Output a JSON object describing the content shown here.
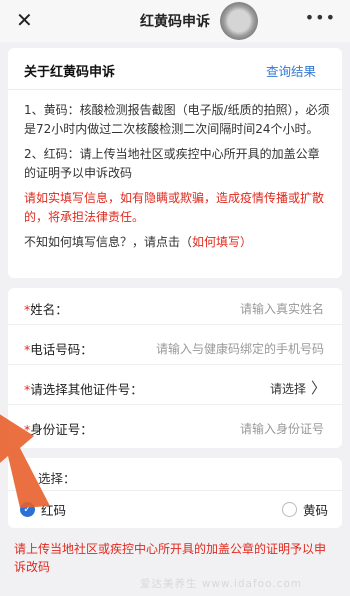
{
  "topbar": {
    "title": "红黄码申诉",
    "close_icon": "close-icon",
    "more_icon": "more-icon"
  },
  "intro": {
    "heading": "关于红黄码申诉",
    "query_link": "查询结果",
    "item1": "1、黄码：核酸检测报告截图（电子版/纸质的拍照），必须是72小时内做过二次核酸检测二次间隔时间24个小时。",
    "item2": "2、红码：请上传当地社区或疾控中心所开具的加盖公章的证明予以申诉改码",
    "warning": "请如实填写信息，如有隐瞒或欺骗，造成疫情传播或扩散的，将承担法律责任。",
    "help_prefix": "不知如何填写信息？，请点击（",
    "help_link": "如何填写",
    "help_suffix": "）"
  },
  "form": {
    "name": {
      "label": "姓名：",
      "placeholder": "请输入真实姓名"
    },
    "phone": {
      "label": "电话号码：",
      "placeholder": "请输入与健康码绑定的手机号码"
    },
    "other_id": {
      "label": "请选择其他证件号：",
      "value": "请选择"
    },
    "id_card": {
      "label": "身份证号：",
      "placeholder": "请输入身份证号"
    }
  },
  "choice": {
    "question": "选择：",
    "options": [
      {
        "label": "红码",
        "selected": true
      },
      {
        "label": "黄码",
        "selected": false
      }
    ]
  },
  "footer_note": "请上传当地社区或疾控中心所开具的加盖公章的证明予以申诉改码",
  "colors": {
    "accent_blue": "#3478d4",
    "warning_red": "#e0291e",
    "arrow_orange": "#e8612c"
  }
}
